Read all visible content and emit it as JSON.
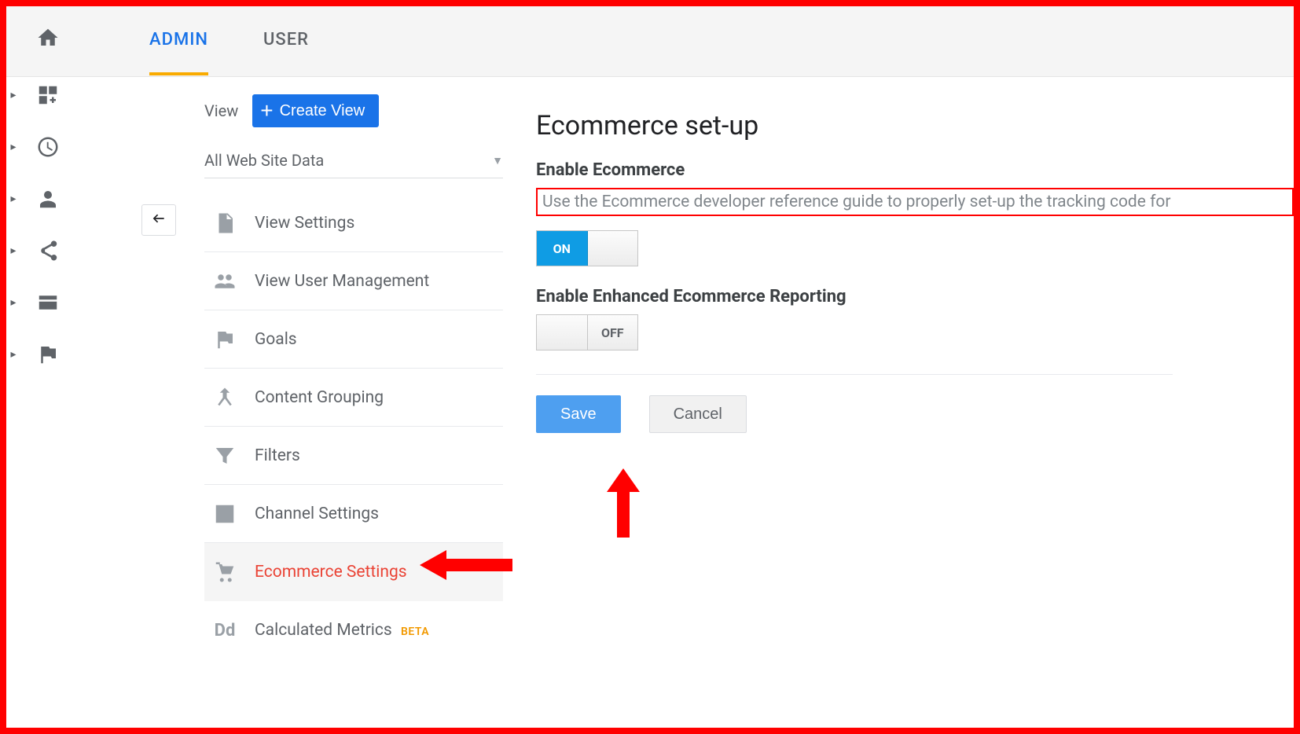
{
  "tabs": {
    "admin": "ADMIN",
    "user": "USER"
  },
  "view_header": {
    "label": "View",
    "create": "Create View"
  },
  "dropdown": {
    "value": "All Web Site Data"
  },
  "menu": {
    "view_settings": "View Settings",
    "view_user_mgmt": "View User Management",
    "goals": "Goals",
    "content_grouping": "Content Grouping",
    "filters": "Filters",
    "channel_settings": "Channel Settings",
    "ecommerce_settings": "Ecommerce Settings",
    "calculated_metrics": "Calculated Metrics",
    "beta": "BETA"
  },
  "main": {
    "title": "Ecommerce set-up",
    "enable_label": "Enable Ecommerce",
    "help_text": "Use the Ecommerce developer reference guide to properly set-up the tracking code for",
    "enhanced_label": "Enable Enhanced Ecommerce Reporting",
    "toggle_on": "ON",
    "toggle_off": "OFF",
    "save": "Save",
    "cancel": "Cancel"
  }
}
